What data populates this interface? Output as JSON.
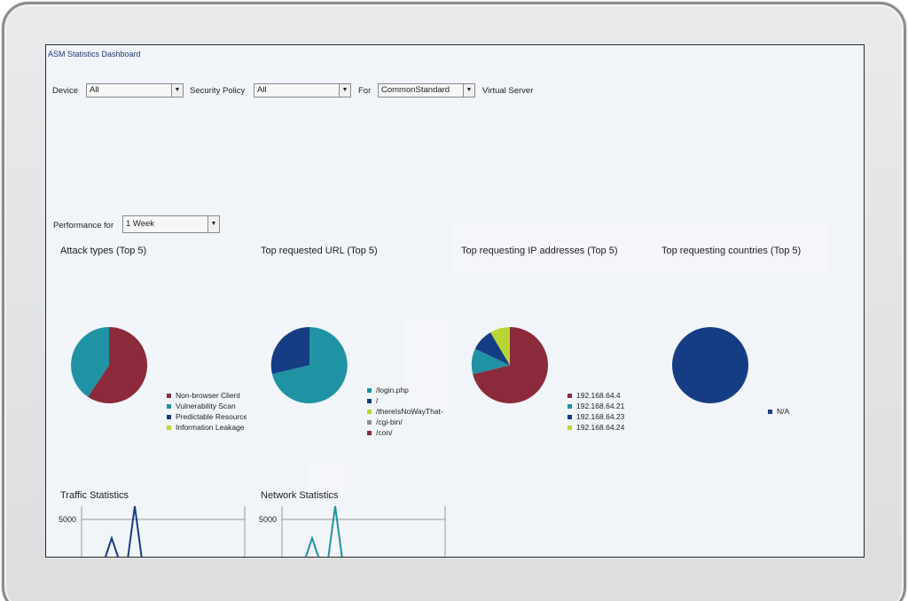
{
  "header": {
    "title": "ASM Statistics Dashboard"
  },
  "filters": {
    "device_label": "Device",
    "device_value": "All",
    "policy_label": "Security Policy",
    "policy_value": "All",
    "for_label": "For",
    "for_value": "CommonStandard",
    "vs_label": "Virtual Server"
  },
  "performance": {
    "label": "Performance for",
    "value": "1 Week"
  },
  "charts": [
    {
      "title": "Attack types (Top 5)",
      "legend": [
        "Non-browser Client",
        "Vulnerability Scan",
        "Predictable Resource",
        "Information Leakage"
      ]
    },
    {
      "title": "Top requested URL (Top 5)",
      "legend": [
        "/login.php",
        "/",
        "/thereIsNoWayThat-",
        "/cgi-bin/",
        "/con/"
      ]
    },
    {
      "title": "Top requesting IP addresses (Top 5)",
      "legend": [
        "192.168.64.4",
        "192.168.64.21",
        "192.168.64.23",
        "192.168.64.24"
      ]
    },
    {
      "title": "Top requesting countries (Top 5)",
      "legend": [
        "N/A"
      ]
    }
  ],
  "colors": {
    "red": "#8b2a3b",
    "teal": "#1f93a3",
    "navy": "#163d84",
    "lime": "#b7d634",
    "gray": "#8a8f96"
  },
  "stats": {
    "traffic_title": "Traffic Statistics",
    "network_title": "Network Statistics",
    "y_tick": "5000"
  },
  "chart_data": [
    {
      "type": "pie",
      "title": "Attack types (Top 5)",
      "categories": [
        "Non-browser Client",
        "Vulnerability Scan",
        "Predictable Resource",
        "Information Leakage"
      ],
      "values": [
        62,
        38,
        0,
        0
      ]
    },
    {
      "type": "pie",
      "title": "Top requested URL (Top 5)",
      "categories": [
        "/login.php",
        "/",
        "/thereIsNoWayThat-",
        "/cgi-bin/",
        "/con/"
      ],
      "values": [
        70,
        30,
        0,
        0,
        0
      ]
    },
    {
      "type": "pie",
      "title": "Top requesting IP addresses (Top 5)",
      "categories": [
        "192.168.64.4",
        "192.168.64.21",
        "192.168.64.23",
        "192.168.64.24"
      ],
      "values": [
        68,
        12,
        10,
        10
      ]
    },
    {
      "type": "pie",
      "title": "Top requesting countries (Top 5)",
      "categories": [
        "N/A"
      ],
      "values": [
        100
      ]
    },
    {
      "type": "line",
      "title": "Traffic Statistics",
      "ylim": [
        0,
        6000
      ],
      "y_ticks": [
        5000
      ],
      "values": [
        0,
        0,
        2500,
        0,
        0,
        7000,
        0,
        0
      ]
    },
    {
      "type": "line",
      "title": "Network Statistics",
      "ylim": [
        0,
        6000
      ],
      "y_ticks": [
        5000
      ],
      "values": [
        0,
        0,
        2500,
        0,
        0,
        7000,
        0,
        0
      ]
    }
  ]
}
